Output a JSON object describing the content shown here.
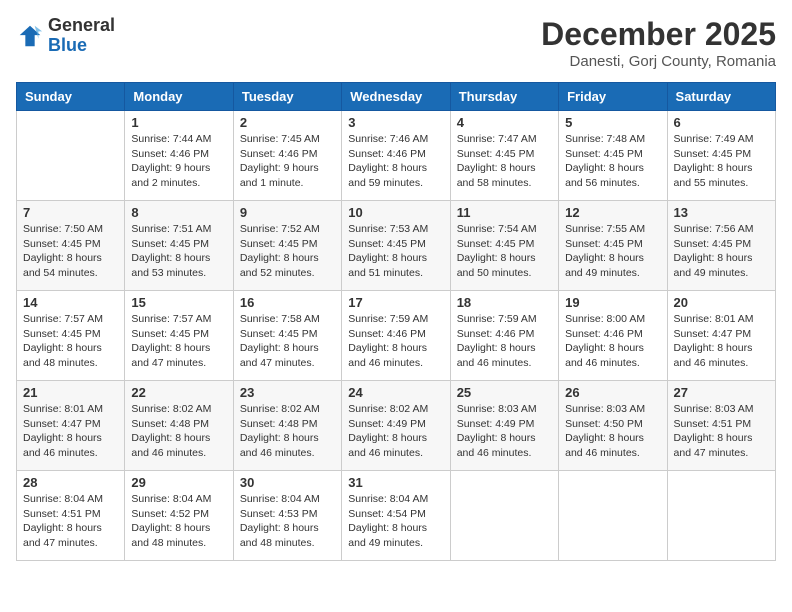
{
  "header": {
    "logo_general": "General",
    "logo_blue": "Blue",
    "month_title": "December 2025",
    "location": "Danesti, Gorj County, Romania"
  },
  "calendar": {
    "days_of_week": [
      "Sunday",
      "Monday",
      "Tuesday",
      "Wednesday",
      "Thursday",
      "Friday",
      "Saturday"
    ],
    "weeks": [
      [
        {
          "day": "",
          "sunrise": "",
          "sunset": "",
          "daylight": ""
        },
        {
          "day": "1",
          "sunrise": "Sunrise: 7:44 AM",
          "sunset": "Sunset: 4:46 PM",
          "daylight": "Daylight: 9 hours and 2 minutes."
        },
        {
          "day": "2",
          "sunrise": "Sunrise: 7:45 AM",
          "sunset": "Sunset: 4:46 PM",
          "daylight": "Daylight: 9 hours and 1 minute."
        },
        {
          "day": "3",
          "sunrise": "Sunrise: 7:46 AM",
          "sunset": "Sunset: 4:46 PM",
          "daylight": "Daylight: 8 hours and 59 minutes."
        },
        {
          "day": "4",
          "sunrise": "Sunrise: 7:47 AM",
          "sunset": "Sunset: 4:45 PM",
          "daylight": "Daylight: 8 hours and 58 minutes."
        },
        {
          "day": "5",
          "sunrise": "Sunrise: 7:48 AM",
          "sunset": "Sunset: 4:45 PM",
          "daylight": "Daylight: 8 hours and 56 minutes."
        },
        {
          "day": "6",
          "sunrise": "Sunrise: 7:49 AM",
          "sunset": "Sunset: 4:45 PM",
          "daylight": "Daylight: 8 hours and 55 minutes."
        }
      ],
      [
        {
          "day": "7",
          "sunrise": "Sunrise: 7:50 AM",
          "sunset": "Sunset: 4:45 PM",
          "daylight": "Daylight: 8 hours and 54 minutes."
        },
        {
          "day": "8",
          "sunrise": "Sunrise: 7:51 AM",
          "sunset": "Sunset: 4:45 PM",
          "daylight": "Daylight: 8 hours and 53 minutes."
        },
        {
          "day": "9",
          "sunrise": "Sunrise: 7:52 AM",
          "sunset": "Sunset: 4:45 PM",
          "daylight": "Daylight: 8 hours and 52 minutes."
        },
        {
          "day": "10",
          "sunrise": "Sunrise: 7:53 AM",
          "sunset": "Sunset: 4:45 PM",
          "daylight": "Daylight: 8 hours and 51 minutes."
        },
        {
          "day": "11",
          "sunrise": "Sunrise: 7:54 AM",
          "sunset": "Sunset: 4:45 PM",
          "daylight": "Daylight: 8 hours and 50 minutes."
        },
        {
          "day": "12",
          "sunrise": "Sunrise: 7:55 AM",
          "sunset": "Sunset: 4:45 PM",
          "daylight": "Daylight: 8 hours and 49 minutes."
        },
        {
          "day": "13",
          "sunrise": "Sunrise: 7:56 AM",
          "sunset": "Sunset: 4:45 PM",
          "daylight": "Daylight: 8 hours and 49 minutes."
        }
      ],
      [
        {
          "day": "14",
          "sunrise": "Sunrise: 7:57 AM",
          "sunset": "Sunset: 4:45 PM",
          "daylight": "Daylight: 8 hours and 48 minutes."
        },
        {
          "day": "15",
          "sunrise": "Sunrise: 7:57 AM",
          "sunset": "Sunset: 4:45 PM",
          "daylight": "Daylight: 8 hours and 47 minutes."
        },
        {
          "day": "16",
          "sunrise": "Sunrise: 7:58 AM",
          "sunset": "Sunset: 4:45 PM",
          "daylight": "Daylight: 8 hours and 47 minutes."
        },
        {
          "day": "17",
          "sunrise": "Sunrise: 7:59 AM",
          "sunset": "Sunset: 4:46 PM",
          "daylight": "Daylight: 8 hours and 46 minutes."
        },
        {
          "day": "18",
          "sunrise": "Sunrise: 7:59 AM",
          "sunset": "Sunset: 4:46 PM",
          "daylight": "Daylight: 8 hours and 46 minutes."
        },
        {
          "day": "19",
          "sunrise": "Sunrise: 8:00 AM",
          "sunset": "Sunset: 4:46 PM",
          "daylight": "Daylight: 8 hours and 46 minutes."
        },
        {
          "day": "20",
          "sunrise": "Sunrise: 8:01 AM",
          "sunset": "Sunset: 4:47 PM",
          "daylight": "Daylight: 8 hours and 46 minutes."
        }
      ],
      [
        {
          "day": "21",
          "sunrise": "Sunrise: 8:01 AM",
          "sunset": "Sunset: 4:47 PM",
          "daylight": "Daylight: 8 hours and 46 minutes."
        },
        {
          "day": "22",
          "sunrise": "Sunrise: 8:02 AM",
          "sunset": "Sunset: 4:48 PM",
          "daylight": "Daylight: 8 hours and 46 minutes."
        },
        {
          "day": "23",
          "sunrise": "Sunrise: 8:02 AM",
          "sunset": "Sunset: 4:48 PM",
          "daylight": "Daylight: 8 hours and 46 minutes."
        },
        {
          "day": "24",
          "sunrise": "Sunrise: 8:02 AM",
          "sunset": "Sunset: 4:49 PM",
          "daylight": "Daylight: 8 hours and 46 minutes."
        },
        {
          "day": "25",
          "sunrise": "Sunrise: 8:03 AM",
          "sunset": "Sunset: 4:49 PM",
          "daylight": "Daylight: 8 hours and 46 minutes."
        },
        {
          "day": "26",
          "sunrise": "Sunrise: 8:03 AM",
          "sunset": "Sunset: 4:50 PM",
          "daylight": "Daylight: 8 hours and 46 minutes."
        },
        {
          "day": "27",
          "sunrise": "Sunrise: 8:03 AM",
          "sunset": "Sunset: 4:51 PM",
          "daylight": "Daylight: 8 hours and 47 minutes."
        }
      ],
      [
        {
          "day": "28",
          "sunrise": "Sunrise: 8:04 AM",
          "sunset": "Sunset: 4:51 PM",
          "daylight": "Daylight: 8 hours and 47 minutes."
        },
        {
          "day": "29",
          "sunrise": "Sunrise: 8:04 AM",
          "sunset": "Sunset: 4:52 PM",
          "daylight": "Daylight: 8 hours and 48 minutes."
        },
        {
          "day": "30",
          "sunrise": "Sunrise: 8:04 AM",
          "sunset": "Sunset: 4:53 PM",
          "daylight": "Daylight: 8 hours and 48 minutes."
        },
        {
          "day": "31",
          "sunrise": "Sunrise: 8:04 AM",
          "sunset": "Sunset: 4:54 PM",
          "daylight": "Daylight: 8 hours and 49 minutes."
        },
        {
          "day": "",
          "sunrise": "",
          "sunset": "",
          "daylight": ""
        },
        {
          "day": "",
          "sunrise": "",
          "sunset": "",
          "daylight": ""
        },
        {
          "day": "",
          "sunrise": "",
          "sunset": "",
          "daylight": ""
        }
      ]
    ]
  }
}
